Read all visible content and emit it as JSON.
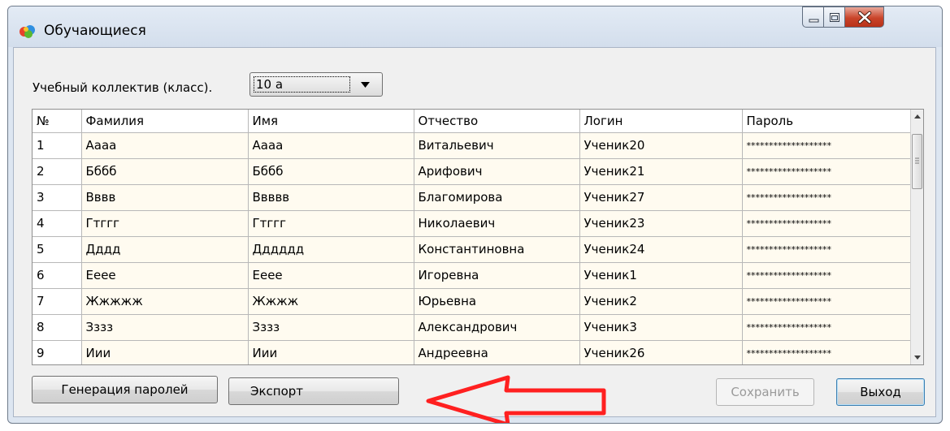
{
  "window": {
    "title": "Обучающиеся",
    "app_icon": "colorful-globe-icon",
    "controls": [
      "minimize-icon",
      "maximize-icon",
      "close-icon"
    ]
  },
  "filter": {
    "label": "Учебный коллектив (класс).",
    "selected": "10 а"
  },
  "table": {
    "columns": [
      "№",
      "Фамилия",
      "Имя",
      "Отчество",
      "Логин",
      "Пароль"
    ],
    "rows": [
      [
        "1",
        "Аааа",
        "Аааа",
        "Витальевич",
        "Ученик20",
        "*******************"
      ],
      [
        "2",
        "Бббб",
        "Бббб",
        "Арифович",
        "Ученик21",
        "*******************"
      ],
      [
        "3",
        "Вввв",
        "Ввввв",
        "Благомирова",
        "Ученик27",
        "*******************"
      ],
      [
        "4",
        "Гтггг",
        "Гтггг",
        "Николаевич",
        "Ученик23",
        "*******************"
      ],
      [
        "5",
        "Дддд",
        "Дддддд",
        "Константиновна",
        "Ученик24",
        "*******************"
      ],
      [
        "6",
        "Еeee",
        "Еeee",
        "Игоревна",
        "Ученик1",
        "*******************"
      ],
      [
        "7",
        "Жжжжж",
        "Жжжж",
        "Юрьевна",
        "Ученик2",
        "*******************"
      ],
      [
        "8",
        "Зззз",
        "Зззз",
        "Александрович",
        "Ученик3",
        "*******************"
      ],
      [
        "9",
        "Иии",
        "Иии",
        "Андреевна",
        "Ученик26",
        "*******************"
      ]
    ]
  },
  "buttons": {
    "generate": "Генерация паролей",
    "export": "Экспорт",
    "save": "Сохранить",
    "exit": "Выход"
  },
  "annotation": {
    "arrow_color": "#ff2020"
  }
}
